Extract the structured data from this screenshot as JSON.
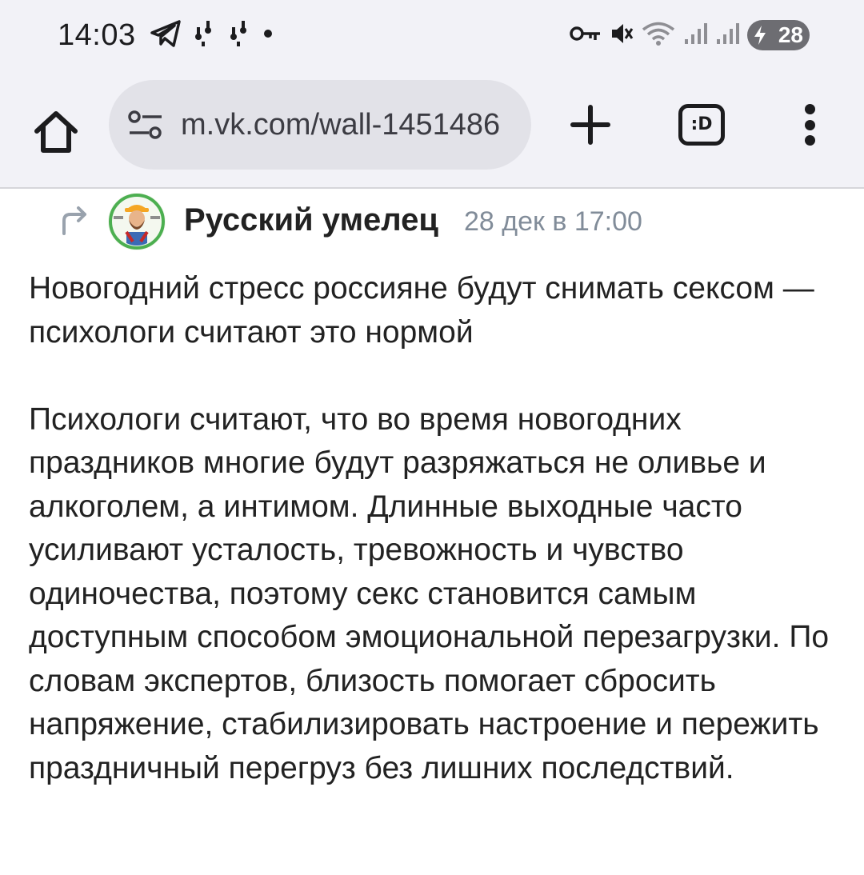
{
  "status_bar": {
    "time": "14:03",
    "left_icons": [
      "telegram-icon",
      "notification-icon",
      "notification-icon",
      "dot-icon"
    ],
    "right_icons": [
      "vpn-key-icon",
      "mute-icon",
      "wifi-icon",
      "signal-icon",
      "signal-icon"
    ],
    "battery_level": "28"
  },
  "browser": {
    "url": "m.vk.com/wall-1451486",
    "tabs_label": ":D"
  },
  "post": {
    "author": "Русский умелец",
    "date": "28 дек в 17:00",
    "headline": "Новогодний стресс россияне будут снимать сексом — психологи считают это нормой",
    "body": "Психологи считают, что во время новогодних праздников многие будут разряжаться не оливье и алкоголем, а интимом. Длинные выходные часто усиливают усталость, тревожность и чувство одиночества, поэтому секс становится самым доступным способом эмоциональной перезагрузки. По словам экспертов, близость помогает сбросить напряжение, стабилизировать настроение и пережить праздничный перегруз без лишних последствий."
  },
  "colors": {
    "toolbar_background": "#f2f2f7",
    "url_field_background": "#e2e2e8",
    "date_text": "#818c99",
    "body_text": "#222222"
  }
}
